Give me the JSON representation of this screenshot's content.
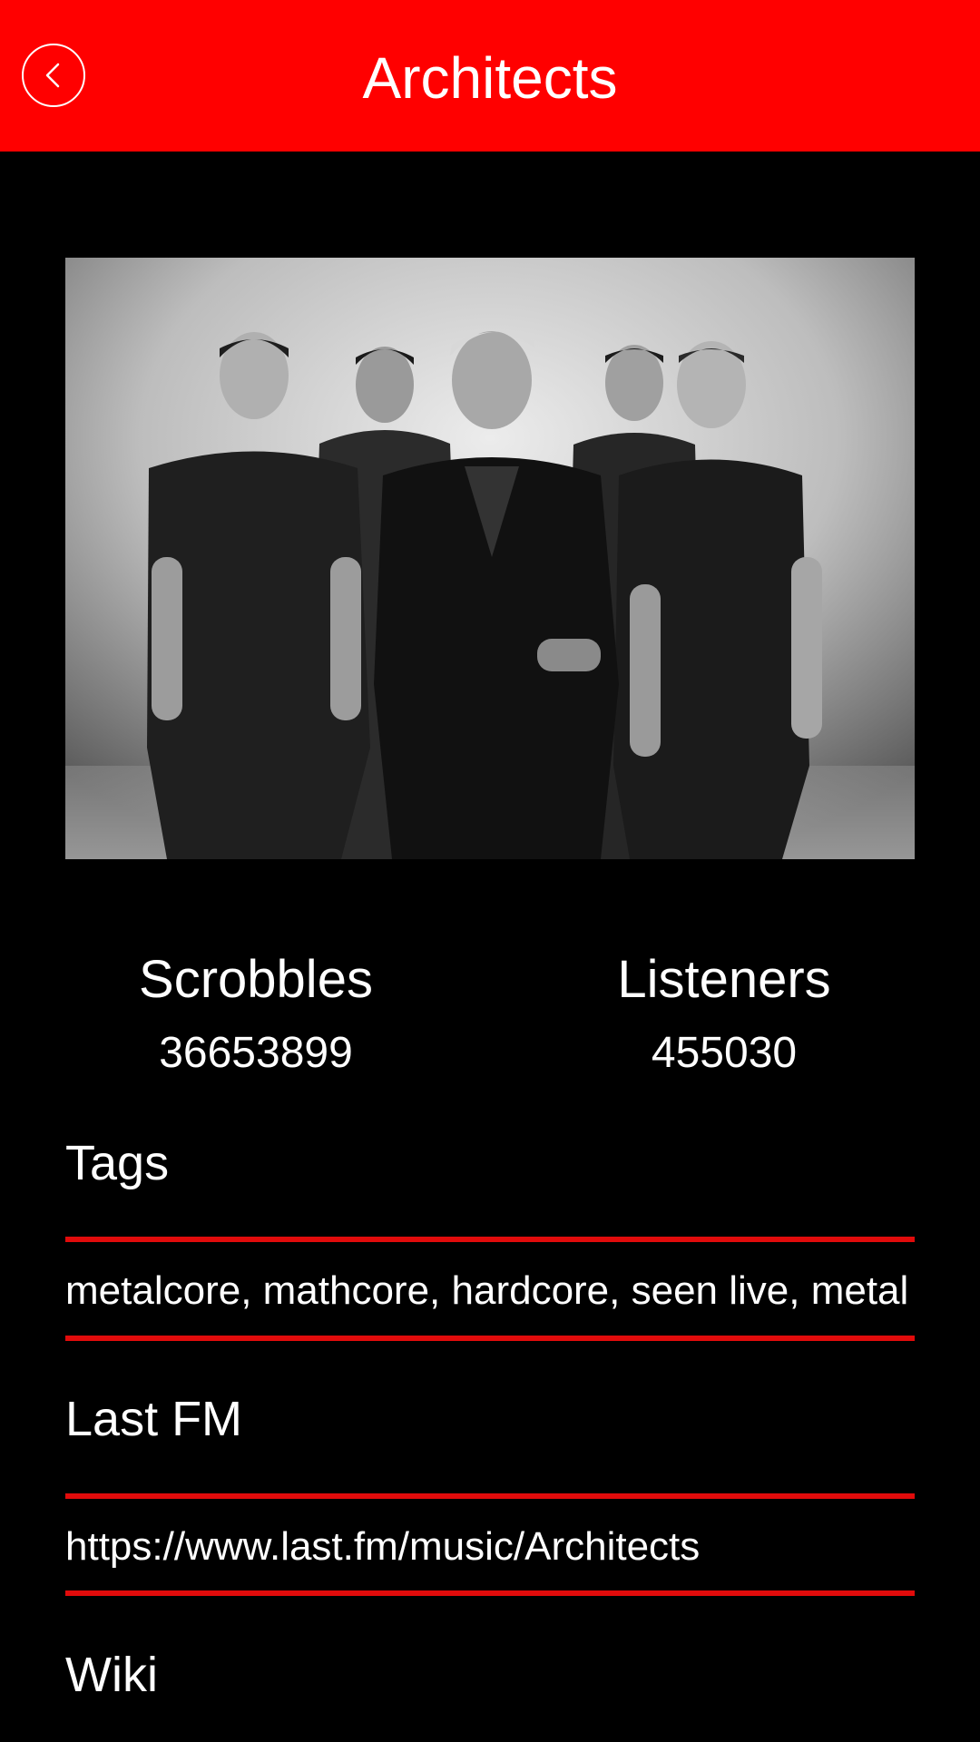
{
  "header": {
    "title": "Architects",
    "back_icon": "chevron-left-icon",
    "background_color": "#ff0000"
  },
  "artist_image": {
    "description_icon": "band-photo"
  },
  "stats": {
    "scrobbles_label": "Scrobbles",
    "scrobbles_value": "36653899",
    "listeners_label": "Listeners",
    "listeners_value": "455030"
  },
  "sections": {
    "tags_heading": "Tags",
    "tags_value": "metalcore, mathcore, hardcore, seen live, metal",
    "lastfm_heading": "Last FM",
    "lastfm_value": "https://www.last.fm/music/Architects",
    "wiki_heading": "Wiki"
  },
  "colors": {
    "accent": "#ff0000",
    "divider": "#e10b0b",
    "background": "#000000",
    "text": "#ffffff"
  }
}
